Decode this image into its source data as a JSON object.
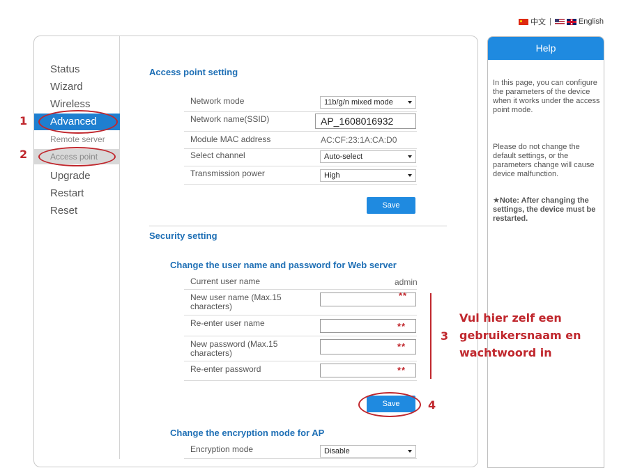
{
  "language": {
    "chinese": "中文",
    "separator": "|",
    "english": "English"
  },
  "nav": {
    "items": [
      "Status",
      "Wizard",
      "Wireless",
      "Advanced",
      "Remote server",
      "Access point",
      "Upgrade",
      "Restart",
      "Reset"
    ]
  },
  "access_point": {
    "title": "Access point setting",
    "network_mode_label": "Network mode",
    "network_mode_value": "11b/g/n mixed mode",
    "ssid_label": "Network name(SSID)",
    "ssid_value": "AP_1608016932",
    "mac_label": "Module MAC address",
    "mac_value": "AC:CF:23:1A:CA:D0",
    "channel_label": "Select channel",
    "channel_value": "Auto-select",
    "power_label": "Transmission power",
    "power_value": "High",
    "save": "Save"
  },
  "security": {
    "title": "Security setting",
    "web_title": "Change the user name and password for Web server",
    "current_user_label": "Current user name",
    "current_user_value": "admin",
    "new_user_label": "New user name (Max.15 characters)",
    "reenter_user_label": "Re-enter user name",
    "new_password_label": "New password (Max.15 characters)",
    "reenter_password_label": "Re-enter password",
    "stars": "**",
    "save": "Save",
    "encryption_title": "Change the encryption mode for AP",
    "encryption_label": "Encryption mode",
    "encryption_value": "Disable"
  },
  "help": {
    "title": "Help",
    "p1": "In this page, you can configure the parameters of the device when it works under the access point mode.",
    "p2": "Please do not change the default settings, or the parameters change will cause device malfunction.",
    "note": "★Note: After changing the settings, the device must be restarted."
  },
  "annotations": {
    "n1": "1",
    "n2": "2",
    "n3": "3",
    "n4": "4",
    "dutch_text": "Vul hier zelf een gebruikersnaam en wachtwoord in",
    "color": "#c0272d"
  },
  "colors": {
    "accent": "#1f8ae0",
    "nav_active": "#1f7fd0",
    "title": "#1e6fb5"
  }
}
